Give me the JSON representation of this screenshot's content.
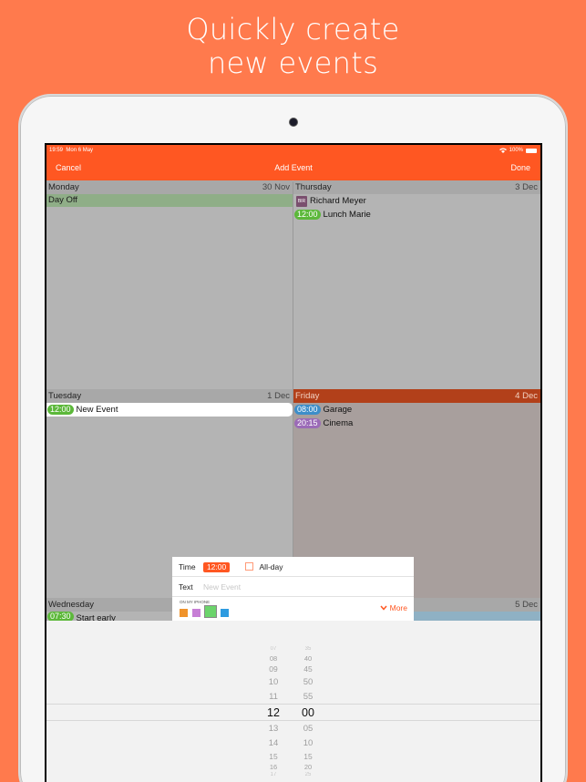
{
  "headline": {
    "line1": "Quickly create",
    "line2": "new events"
  },
  "status_bar": {
    "time": "19:59",
    "date": "Mon 6 May",
    "battery": "100%"
  },
  "nav": {
    "cancel": "Cancel",
    "title": "Add Event",
    "done": "Done"
  },
  "days": {
    "monday": {
      "name": "Monday",
      "date": "30 Nov",
      "allday": "Day Off"
    },
    "thursday": {
      "name": "Thursday",
      "date": "3 Dec",
      "birthday_icon": "BIR",
      "birthday": "Richard Meyer",
      "event": {
        "time": "12:00",
        "title": "Lunch Marie"
      }
    },
    "tuesday": {
      "name": "Tuesday",
      "date": "1 Dec",
      "event": {
        "time": "12:00",
        "title": "New Event"
      }
    },
    "friday": {
      "name": "Friday",
      "date": "4 Dec",
      "events": [
        {
          "time": "08:00",
          "title": "Garage",
          "color": "#3d8ec9"
        },
        {
          "time": "20:15",
          "title": "Cinema",
          "color": "#9b6bb7"
        }
      ]
    },
    "wednesday": {
      "name": "Wednesday",
      "date": "",
      "event": {
        "time": "07:30",
        "title": "Start early"
      }
    },
    "saturday": {
      "date": "5 Dec"
    }
  },
  "popup": {
    "time_label": "Time",
    "time_value": "12:00",
    "allday_label": "All-day",
    "text_label": "Text",
    "text_placeholder": "New Event",
    "calendar_label": "ON MY IPHONE",
    "swatches": [
      "#f0932b",
      "#c77fd6",
      "#6cd46c",
      "#2d9be0"
    ],
    "more_label": "More"
  },
  "picker": {
    "hours": [
      "07",
      "08",
      "09",
      "10",
      "11",
      "12",
      "13",
      "14",
      "15",
      "16",
      "17"
    ],
    "minutes": [
      "35",
      "40",
      "45",
      "50",
      "55",
      "00",
      "05",
      "10",
      "15",
      "20",
      "25"
    ],
    "selected_hour": "12",
    "selected_minute": "00"
  },
  "colors": {
    "accent": "#ff5722",
    "background": "#ff7a4d",
    "event_green": "#5cb83a",
    "friday_header": "#b2401a"
  }
}
